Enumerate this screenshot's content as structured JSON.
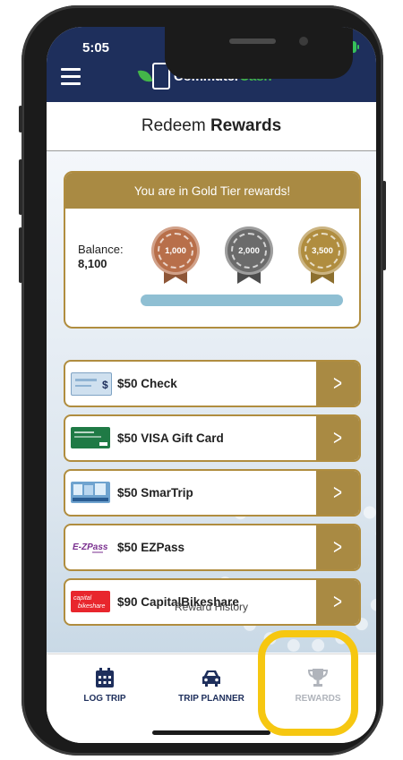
{
  "status_bar": {
    "time": "5:05"
  },
  "header": {
    "brand_part1": "Commuter",
    "brand_part2": "Cash",
    "brand_color_primary": "#1e2f5c",
    "brand_color_accent": "#43b649"
  },
  "page": {
    "title_regular": "Redeem ",
    "title_bold": "Rewards"
  },
  "tier_card": {
    "banner": "You are in Gold Tier rewards!",
    "balance_label": "Balance:",
    "balance_value": "8,100",
    "medals": [
      {
        "label": "1,000",
        "color": "#b86f4a",
        "icon": "bronze-medal-icon"
      },
      {
        "label": "2,000",
        "color": "#6b6b6b",
        "icon": "silver-medal-icon"
      },
      {
        "label": "3,500",
        "color": "#b08d3f",
        "icon": "gold-medal-icon"
      }
    ],
    "progress_fraction": 1.0
  },
  "rewards": [
    {
      "label": "$50 Check",
      "icon": "check-thumbnail"
    },
    {
      "label": "$50 VISA Gift Card",
      "icon": "visa-card-thumbnail"
    },
    {
      "label": "$50 SmarTrip",
      "icon": "smartrip-card-thumbnail"
    },
    {
      "label": "$50 EZPass",
      "icon": "ezpass-logo"
    },
    {
      "label": "$90 CapitalBikeshare",
      "icon": "capital-bikeshare-logo"
    }
  ],
  "reward_history_link": "Reward History",
  "nav": {
    "items": [
      {
        "label": "LOG TRIP",
        "icon": "calendar-icon"
      },
      {
        "label": "TRIP PLANNER",
        "icon": "car-icon"
      },
      {
        "label": "REWARDS",
        "icon": "trophy-icon"
      }
    ]
  },
  "highlight_color": "#f6c711"
}
